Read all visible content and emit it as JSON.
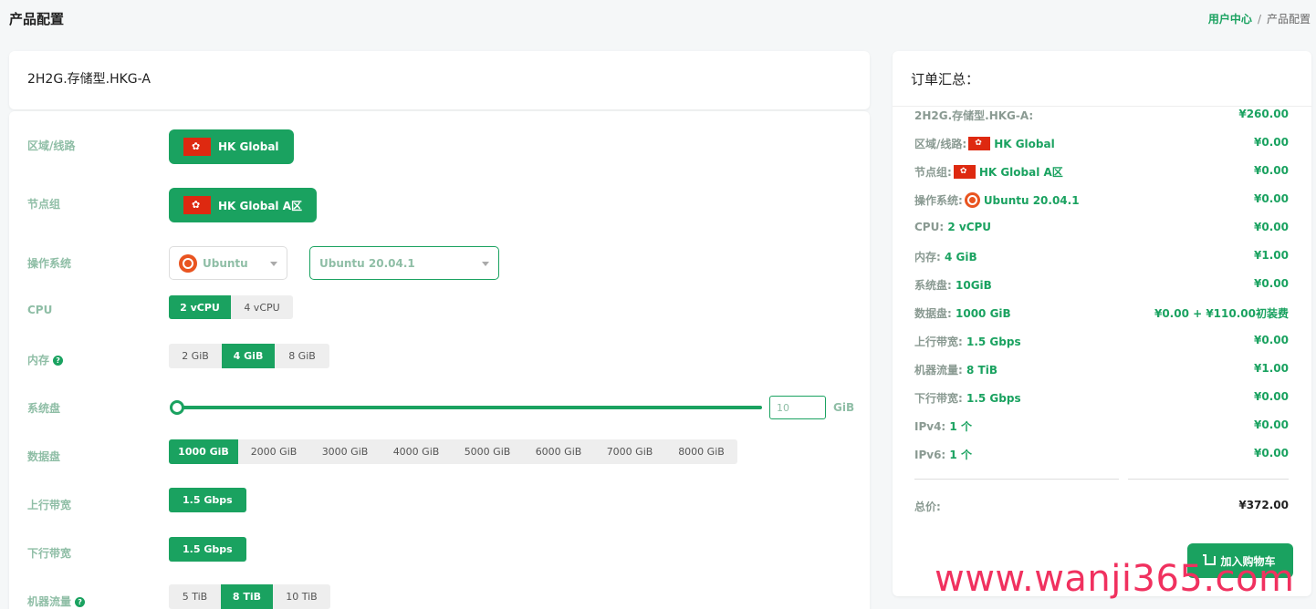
{
  "header": {
    "title": "产品配置",
    "breadcrumb": {
      "home": "用户中心",
      "sep": "/",
      "current": "产品配置"
    }
  },
  "product": {
    "name": "2H2G.存储型.HKG-A"
  },
  "config": {
    "region": {
      "label": "区域/线路",
      "value": "HK Global"
    },
    "node_group": {
      "label": "节点组",
      "value": "HK Global A区"
    },
    "os": {
      "label": "操作系统",
      "os_value": "Ubuntu",
      "version_value": "Ubuntu 20.04.1"
    },
    "cpu": {
      "label": "CPU",
      "options": [
        "2 vCPU",
        "4 vCPU"
      ],
      "selected": 0
    },
    "memory": {
      "label": "内存",
      "options": [
        "2 GiB",
        "4 GiB",
        "8 GiB"
      ],
      "selected": 1
    },
    "system_disk": {
      "label": "系统盘",
      "value": "10",
      "unit": "GiB"
    },
    "data_disk": {
      "label": "数据盘",
      "options": [
        "1000 GiB",
        "2000 GiB",
        "3000 GiB",
        "4000 GiB",
        "5000 GiB",
        "6000 GiB",
        "7000 GiB",
        "8000 GiB"
      ],
      "selected": 0
    },
    "upload": {
      "label": "上行带宽",
      "value": "1.5 Gbps"
    },
    "download": {
      "label": "下行带宽",
      "value": "1.5 Gbps"
    },
    "traffic": {
      "label": "机器流量",
      "options": [
        "5 TiB",
        "8 TiB",
        "10 TiB"
      ],
      "selected": 1
    }
  },
  "summary": {
    "title": "订单汇总：",
    "rows": [
      {
        "key": "2H2G.存储型.HKG-A:",
        "value": "",
        "price": "¥260.00"
      },
      {
        "key": "区域/线路:",
        "value": "HK Global",
        "price": "¥0.00"
      },
      {
        "key": "节点组:",
        "value": "HK Global A区",
        "price": "¥0.00"
      },
      {
        "key": "操作系统:",
        "value": "Ubuntu 20.04.1",
        "price": "¥0.00"
      },
      {
        "key": "CPU:",
        "value": "2 vCPU",
        "price": "¥0.00"
      },
      {
        "key": "内存:",
        "value": "4 GiB",
        "price": "¥1.00"
      },
      {
        "key": "系统盘:",
        "value": "10GiB",
        "price": "¥0.00"
      },
      {
        "key": "数据盘:",
        "value": "1000 GiB",
        "price": "¥0.00 + ¥110.00初装费"
      },
      {
        "key": "上行带宽:",
        "value": "1.5 Gbps",
        "price": "¥0.00"
      },
      {
        "key": "机器流量:",
        "value": "8 TiB",
        "price": "¥1.00"
      },
      {
        "key": "下行带宽:",
        "value": "1.5 Gbps",
        "price": "¥0.00"
      },
      {
        "key": "IPv4:",
        "value": "1 个",
        "price": "¥0.00"
      },
      {
        "key": "IPv6:",
        "value": "1 个",
        "price": "¥0.00"
      }
    ],
    "total_label": "总价:",
    "total_price": "¥372.00",
    "cart_button": "加入购物车"
  },
  "watermark": "www.wanji365.com",
  "colors": {
    "accent": "#1aa260",
    "label": "#8fbea6",
    "flag": "#de2910",
    "ubuntu": "#e95420"
  }
}
